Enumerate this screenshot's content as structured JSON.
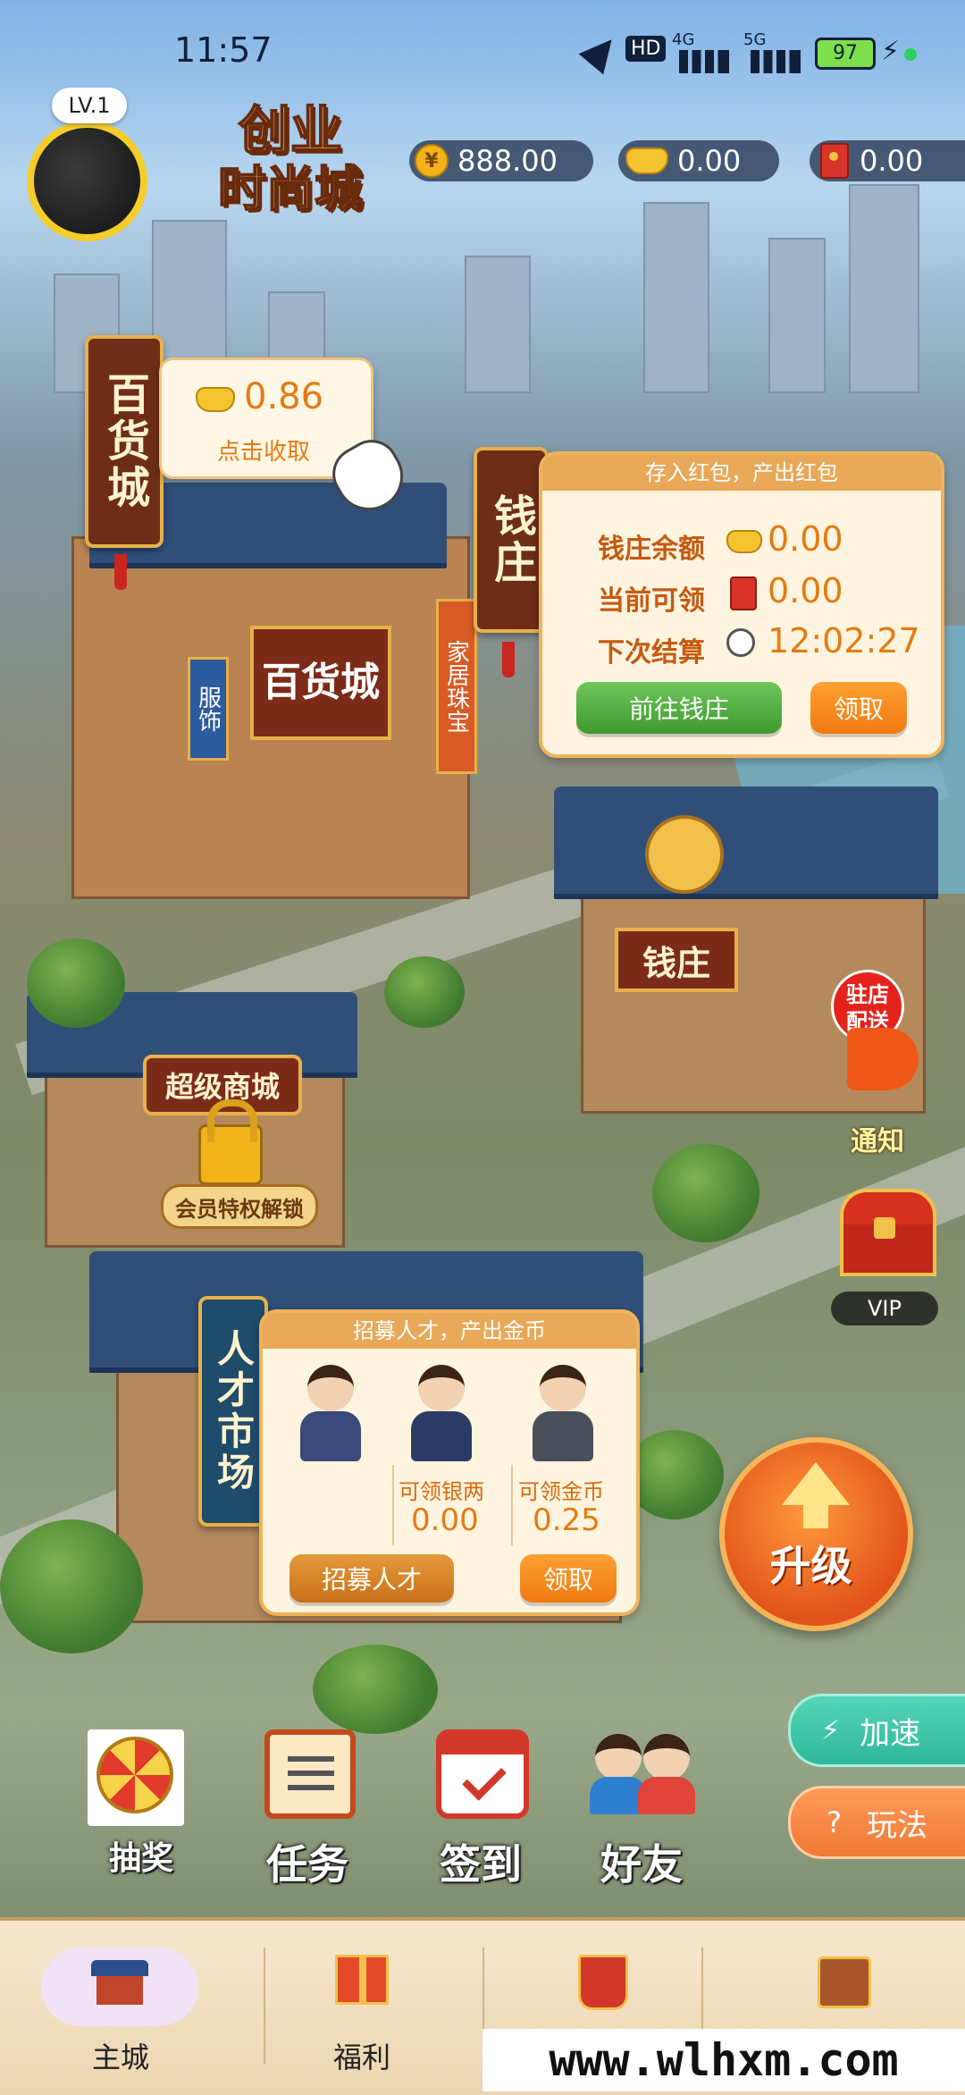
{
  "status_bar": {
    "time": "11:57",
    "network_badge": "HD",
    "net_4g": "4G",
    "net_5g": "5G",
    "battery": "97"
  },
  "header": {
    "level": "LV.1",
    "logo_line1": "创业",
    "logo_line2": "时尚城",
    "currency_yuan": "888.00",
    "currency_silver": "0.00",
    "currency_redpacket": "0.00"
  },
  "department_store": {
    "sign": "百货城",
    "collect_amount": "0.86",
    "collect_hint": "点击收取",
    "building_sign": "百货城",
    "side_sign_1": "服饰",
    "side_sign_2": "家居珠宝"
  },
  "bank": {
    "sign": "钱庄",
    "panel_title": "存入红包，产出红包",
    "balance_label": "钱庄余额",
    "balance_value": "0.00",
    "claimable_label": "当前可领",
    "claimable_value": "0.00",
    "next_settle_label": "下次结算",
    "next_settle_value": "12:02:27",
    "goto_button": "前往钱庄",
    "claim_button": "领取",
    "building_sign": "钱庄"
  },
  "side_actions": {
    "delivery_badge": "驻店配送",
    "notice_label": "通知",
    "vip_label": "VIP",
    "upgrade_button": "升级",
    "speedup_button": "加速",
    "howto_button": "玩法"
  },
  "super_mall": {
    "sign": "超级商城",
    "unlock_hint": "会员特权解锁"
  },
  "talent_market": {
    "sign": "人才市场",
    "panel_title": "招募人才，产出金币",
    "silver_label": "可领银两",
    "silver_value": "0.00",
    "gold_label": "可领金币",
    "gold_value": "0.25",
    "recruit_button": "招募人才",
    "claim_button": "领取"
  },
  "quick_actions": {
    "lottery": "抽奖",
    "tasks": "任务",
    "checkin": "签到",
    "friends": "好友"
  },
  "bottom_nav": {
    "main_city": "主城",
    "welfare": "福利"
  },
  "watermark": "www.wlhxm.com",
  "colors": {
    "accent_orange": "#f07a10",
    "accent_green": "#3f9a30",
    "sign_brown": "#6e2d16",
    "gold": "#e7b04a",
    "speedup_teal": "#2fb79a",
    "howto_orange": "#f07a34"
  }
}
